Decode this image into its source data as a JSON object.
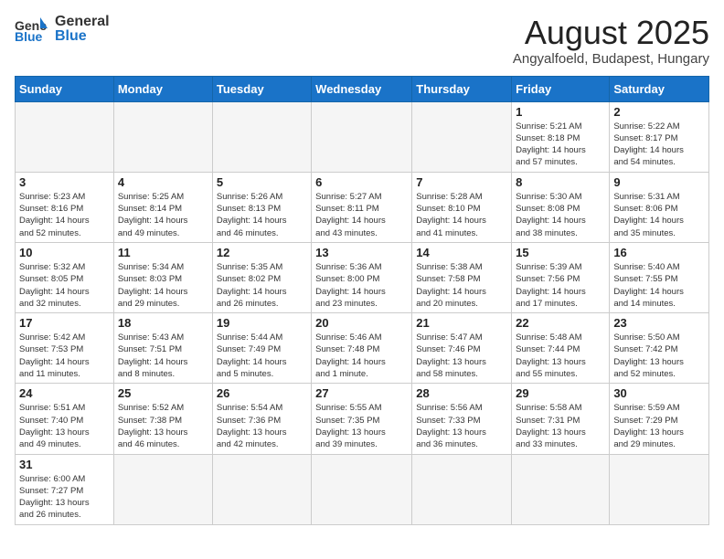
{
  "header": {
    "logo_general": "General",
    "logo_blue": "Blue",
    "title": "August 2025",
    "subtitle": "Angyalfoeld, Budapest, Hungary"
  },
  "weekdays": [
    "Sunday",
    "Monday",
    "Tuesday",
    "Wednesday",
    "Thursday",
    "Friday",
    "Saturday"
  ],
  "days": [
    {
      "date": "",
      "info": ""
    },
    {
      "date": "",
      "info": ""
    },
    {
      "date": "",
      "info": ""
    },
    {
      "date": "",
      "info": ""
    },
    {
      "date": "",
      "info": ""
    },
    {
      "date": "1",
      "info": "Sunrise: 5:21 AM\nSunset: 8:18 PM\nDaylight: 14 hours\nand 57 minutes."
    },
    {
      "date": "2",
      "info": "Sunrise: 5:22 AM\nSunset: 8:17 PM\nDaylight: 14 hours\nand 54 minutes."
    },
    {
      "date": "3",
      "info": "Sunrise: 5:23 AM\nSunset: 8:16 PM\nDaylight: 14 hours\nand 52 minutes."
    },
    {
      "date": "4",
      "info": "Sunrise: 5:25 AM\nSunset: 8:14 PM\nDaylight: 14 hours\nand 49 minutes."
    },
    {
      "date": "5",
      "info": "Sunrise: 5:26 AM\nSunset: 8:13 PM\nDaylight: 14 hours\nand 46 minutes."
    },
    {
      "date": "6",
      "info": "Sunrise: 5:27 AM\nSunset: 8:11 PM\nDaylight: 14 hours\nand 43 minutes."
    },
    {
      "date": "7",
      "info": "Sunrise: 5:28 AM\nSunset: 8:10 PM\nDaylight: 14 hours\nand 41 minutes."
    },
    {
      "date": "8",
      "info": "Sunrise: 5:30 AM\nSunset: 8:08 PM\nDaylight: 14 hours\nand 38 minutes."
    },
    {
      "date": "9",
      "info": "Sunrise: 5:31 AM\nSunset: 8:06 PM\nDaylight: 14 hours\nand 35 minutes."
    },
    {
      "date": "10",
      "info": "Sunrise: 5:32 AM\nSunset: 8:05 PM\nDaylight: 14 hours\nand 32 minutes."
    },
    {
      "date": "11",
      "info": "Sunrise: 5:34 AM\nSunset: 8:03 PM\nDaylight: 14 hours\nand 29 minutes."
    },
    {
      "date": "12",
      "info": "Sunrise: 5:35 AM\nSunset: 8:02 PM\nDaylight: 14 hours\nand 26 minutes."
    },
    {
      "date": "13",
      "info": "Sunrise: 5:36 AM\nSunset: 8:00 PM\nDaylight: 14 hours\nand 23 minutes."
    },
    {
      "date": "14",
      "info": "Sunrise: 5:38 AM\nSunset: 7:58 PM\nDaylight: 14 hours\nand 20 minutes."
    },
    {
      "date": "15",
      "info": "Sunrise: 5:39 AM\nSunset: 7:56 PM\nDaylight: 14 hours\nand 17 minutes."
    },
    {
      "date": "16",
      "info": "Sunrise: 5:40 AM\nSunset: 7:55 PM\nDaylight: 14 hours\nand 14 minutes."
    },
    {
      "date": "17",
      "info": "Sunrise: 5:42 AM\nSunset: 7:53 PM\nDaylight: 14 hours\nand 11 minutes."
    },
    {
      "date": "18",
      "info": "Sunrise: 5:43 AM\nSunset: 7:51 PM\nDaylight: 14 hours\nand 8 minutes."
    },
    {
      "date": "19",
      "info": "Sunrise: 5:44 AM\nSunset: 7:49 PM\nDaylight: 14 hours\nand 5 minutes."
    },
    {
      "date": "20",
      "info": "Sunrise: 5:46 AM\nSunset: 7:48 PM\nDaylight: 14 hours\nand 1 minute."
    },
    {
      "date": "21",
      "info": "Sunrise: 5:47 AM\nSunset: 7:46 PM\nDaylight: 13 hours\nand 58 minutes."
    },
    {
      "date": "22",
      "info": "Sunrise: 5:48 AM\nSunset: 7:44 PM\nDaylight: 13 hours\nand 55 minutes."
    },
    {
      "date": "23",
      "info": "Sunrise: 5:50 AM\nSunset: 7:42 PM\nDaylight: 13 hours\nand 52 minutes."
    },
    {
      "date": "24",
      "info": "Sunrise: 5:51 AM\nSunset: 7:40 PM\nDaylight: 13 hours\nand 49 minutes."
    },
    {
      "date": "25",
      "info": "Sunrise: 5:52 AM\nSunset: 7:38 PM\nDaylight: 13 hours\nand 46 minutes."
    },
    {
      "date": "26",
      "info": "Sunrise: 5:54 AM\nSunset: 7:36 PM\nDaylight: 13 hours\nand 42 minutes."
    },
    {
      "date": "27",
      "info": "Sunrise: 5:55 AM\nSunset: 7:35 PM\nDaylight: 13 hours\nand 39 minutes."
    },
    {
      "date": "28",
      "info": "Sunrise: 5:56 AM\nSunset: 7:33 PM\nDaylight: 13 hours\nand 36 minutes."
    },
    {
      "date": "29",
      "info": "Sunrise: 5:58 AM\nSunset: 7:31 PM\nDaylight: 13 hours\nand 33 minutes."
    },
    {
      "date": "30",
      "info": "Sunrise: 5:59 AM\nSunset: 7:29 PM\nDaylight: 13 hours\nand 29 minutes."
    },
    {
      "date": "31",
      "info": "Sunrise: 6:00 AM\nSunset: 7:27 PM\nDaylight: 13 hours\nand 26 minutes."
    }
  ]
}
